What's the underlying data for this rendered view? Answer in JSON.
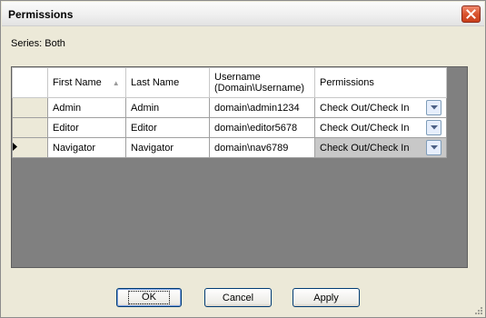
{
  "window": {
    "title": "Permissions",
    "series_text": "Series: Both"
  },
  "grid": {
    "columns": [
      {
        "label": "First Name",
        "sorted": "ascending"
      },
      {
        "label": "Last Name"
      },
      {
        "label": "Username\n(Domain\\Username)"
      },
      {
        "label": "Permissions"
      }
    ],
    "rows": [
      {
        "first": "Admin",
        "last": "Admin",
        "username": "domain\\admin1234",
        "permission": "Check Out/Check In",
        "current": false
      },
      {
        "first": "Editor",
        "last": "Editor",
        "username": "domain\\editor5678",
        "permission": "Check Out/Check In",
        "current": false
      },
      {
        "first": "Navigator",
        "last": "Navigator",
        "username": "domain\\nav6789",
        "permission": "Check Out/Check In",
        "current": true
      }
    ]
  },
  "buttons": {
    "ok": "OK",
    "cancel": "Cancel",
    "apply": "Apply"
  },
  "colors": {
    "grid_background": "#808080",
    "dialog_background": "#ece9d8",
    "close_button": "#d9532e"
  },
  "icons": {
    "close": "close-icon",
    "sort": "sort-ascending-icon",
    "dropdown": "chevron-down-icon",
    "current_row": "row-pointer-icon",
    "resize": "resize-grip-icon"
  }
}
